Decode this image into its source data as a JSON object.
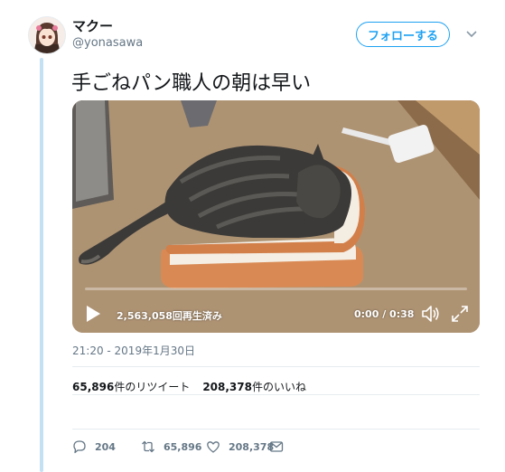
{
  "user": {
    "display_name": "マクー",
    "handle": "@yonasawa"
  },
  "follow_label": "フォローする",
  "tweet_text": "手ごねパン職人の朝は早い",
  "video": {
    "view_count_text": "2,563,058回再生済み",
    "time_text": "0:00 / 0:38",
    "progress": 0
  },
  "timestamp": "21:20 - 2019年1月30日",
  "stats": {
    "retweets_number": "65,896",
    "retweets_suffix": "件のリツイート",
    "likes_number": "208,378",
    "likes_suffix": "件のいいね"
  },
  "actions": {
    "replies": "204",
    "retweets": "65,896",
    "likes": "208,378"
  },
  "colors": {
    "accent": "#1da1f2",
    "muted": "#657786",
    "thread_line": "#c4e1f4"
  },
  "icons": [
    "avatar",
    "chevron-down-icon",
    "play-icon",
    "volume-icon",
    "fullscreen-icon",
    "reply-icon",
    "retweet-icon",
    "like-icon",
    "message-icon"
  ]
}
